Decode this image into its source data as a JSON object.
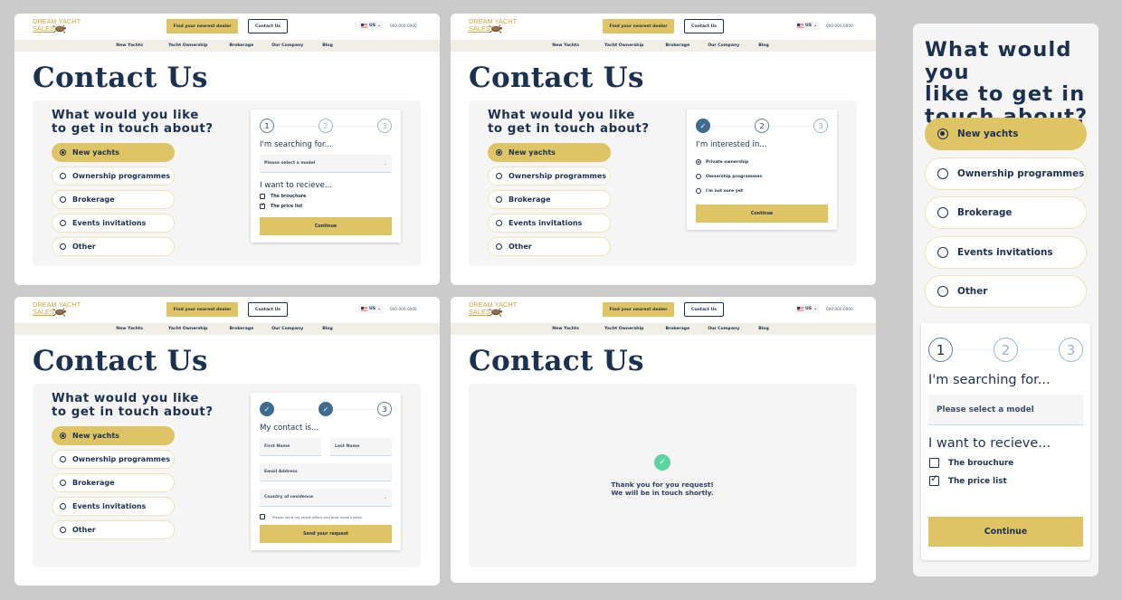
{
  "header": {
    "logo_line1": "DREAM YACHT",
    "logo_line2": "SALES",
    "dealer_button": "Find your nearest dealer",
    "contact_button": "Contact Us",
    "locale": "US",
    "phone": "000-000-0000",
    "nav": [
      "New Yachts",
      "Yacht Ownership",
      "Brokerage",
      "Our Company",
      "Blog"
    ]
  },
  "page_title": "Contact Us",
  "question": {
    "title": "What would you like to get in touch about?",
    "title_line1": "What would you like",
    "title_line2": "to get in touch about?",
    "options": [
      "New yachts",
      "Ownership programmes",
      "Brokerage",
      "Events invitations",
      "Other"
    ],
    "selected_index": 0
  },
  "mobile": {
    "title_line1": "What would you",
    "title_line2": "like to get in",
    "title_line3": "touch about?"
  },
  "steps": [
    "1",
    "2",
    "3"
  ],
  "step1": {
    "heading": "I'm searching for...",
    "model_placeholder": "Please select a model",
    "receive_heading": "I want to recieve...",
    "checkboxes": [
      {
        "label": "The brouchure",
        "checked": false
      },
      {
        "label": "The price list",
        "checked": true
      }
    ],
    "cta": "Continue"
  },
  "step2": {
    "heading": "I'm interested in...",
    "options": [
      "Private ownership",
      "Ownership programmes",
      "I'm not sure yet"
    ],
    "selected_index": 0,
    "cta": "Continue"
  },
  "step3": {
    "heading": "My contact is...",
    "first_name_placeholder": "First Name",
    "last_name_placeholder": "Last Name",
    "email_placeholder": "Email Address",
    "country_placeholder": "Country of residence",
    "consent_label": "Please send me latest offers and boat show invites",
    "consent_checked": false,
    "cta": "Send your request"
  },
  "success": {
    "line1": "Thank you for you request!",
    "line2": "We will be in touch shortly."
  },
  "colors": {
    "brand_gold": "#dfc466",
    "navy": "#1c3150",
    "step_done": "#3f6c8e",
    "success_green": "#5cd4a2",
    "nav_bg": "#f1eee6"
  }
}
